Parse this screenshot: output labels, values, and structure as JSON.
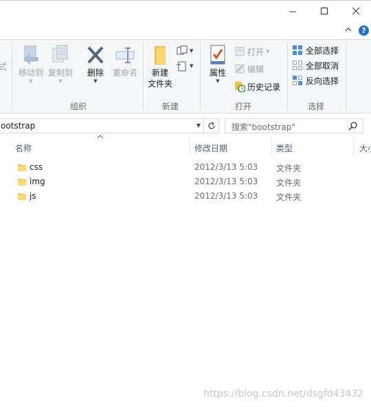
{
  "window": {
    "minimize_glyph": "minimize-icon",
    "maximize_glyph": "maximize-icon",
    "close_glyph": "close-icon"
  },
  "ribbon": {
    "clipped_label": "式",
    "organize": {
      "label": "组织",
      "move_to": "移动到",
      "copy_to": "复制到",
      "delete": "删除",
      "rename": "重命名"
    },
    "new": {
      "label": "新建",
      "new_folder_line1": "新建",
      "new_folder_line2": "文件夹"
    },
    "open": {
      "label": "打开",
      "properties": "属性",
      "open": "打开",
      "edit": "编辑",
      "history": "历史记录"
    },
    "select": {
      "label": "选择",
      "select_all": "全部选择",
      "select_none": "全部取消",
      "invert": "反向选择"
    }
  },
  "address": {
    "path": "ootstrap",
    "search_placeholder": "搜索\"bootstrap\""
  },
  "columns": {
    "name": "名称",
    "modified": "修改日期",
    "type": "类型",
    "size": "大小"
  },
  "files": [
    {
      "name": "css",
      "date": "2012/3/13 5:03",
      "type": "文件夹"
    },
    {
      "name": "img",
      "date": "2012/3/13 5:03",
      "type": "文件夹"
    },
    {
      "name": "js",
      "date": "2012/3/13 5:03",
      "type": "文件夹"
    }
  ],
  "watermark": "https://blog.csdn.net/dsgfd43432",
  "colors": {
    "accent": "#1e6fd0",
    "folder": "#f8d775",
    "header_text": "#4c607a"
  }
}
